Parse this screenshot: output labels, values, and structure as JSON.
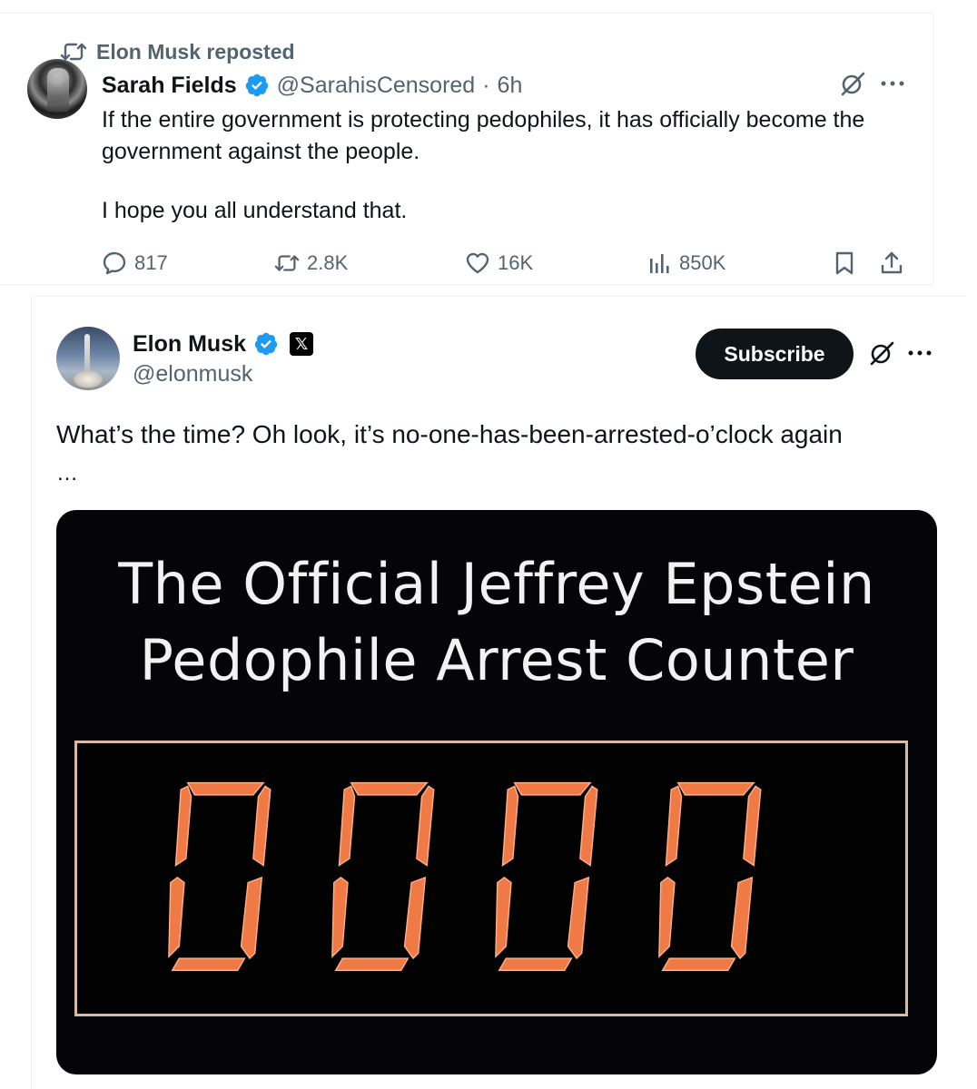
{
  "repost": {
    "label": "Elon Musk reposted",
    "icon": "repost-icon"
  },
  "top_tweet": {
    "author_name": "Sarah Fields",
    "handle": "@SarahisCensored",
    "separator": "·",
    "time": "6h",
    "verified": true,
    "text_line1": "If the entire government is protecting pedophiles, it has officially become the government against the people.",
    "text_line2": "I hope you all understand that.",
    "metrics": {
      "replies": "817",
      "reposts": "2.8K",
      "likes": "16K",
      "views": "850K"
    },
    "colors": {
      "verified": "#1d9bf0",
      "muted": "#536471"
    }
  },
  "bottom_tweet": {
    "author_name": "Elon Musk",
    "handle": "@elonmusk",
    "verified": true,
    "affiliate_badge": "𝕏",
    "subscribe_label": "Subscribe",
    "text": "What’s the time? Oh look, it’s no-one-has-been-arrested-o’clock again",
    "more": "…",
    "media": {
      "title_line1": "The Official Jeffrey Epstein",
      "title_line2": "Pedophile Arrest Counter",
      "counter_value": "0000",
      "digit_color": "#f07a45"
    }
  }
}
